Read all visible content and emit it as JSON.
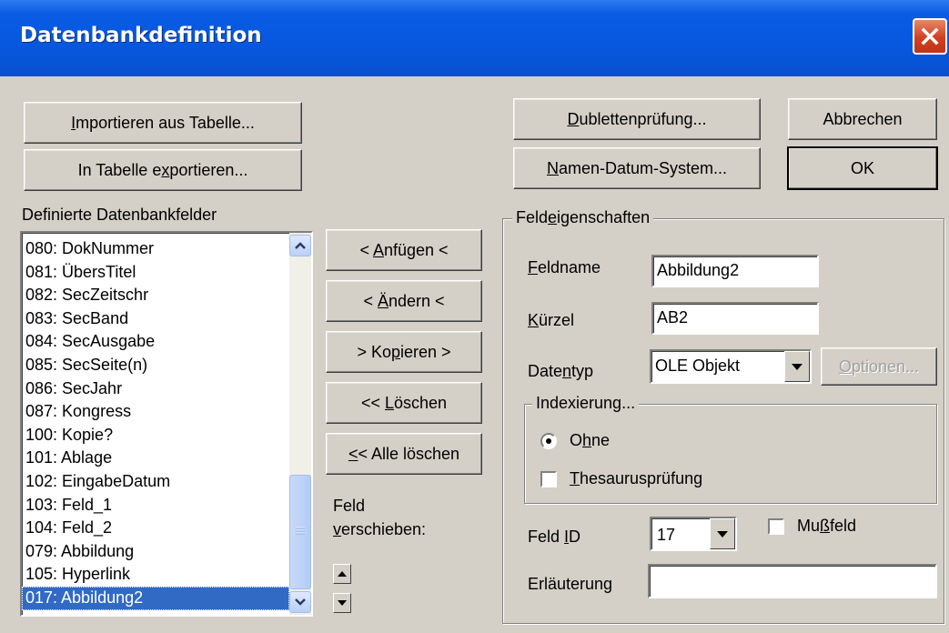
{
  "window": {
    "title": "Datenbankdefinition",
    "close_icon": "close-icon"
  },
  "buttons": {
    "import": {
      "pre": "",
      "key": "I",
      "post": "mportieren aus Tabelle..."
    },
    "export": {
      "pre": "In Tabelle e",
      "key": "x",
      "post": "portieren..."
    },
    "dubletten": {
      "pre": "",
      "key": "D",
      "post": "ublettenprüfung..."
    },
    "abbrechen": "Abbrechen",
    "namen": {
      "pre": "",
      "key": "N",
      "post": "amen-Datum-System..."
    },
    "ok": "OK",
    "anfuegen": {
      "pre": "< ",
      "key": "A",
      "post": "nfügen <"
    },
    "aendern": {
      "pre": "< ",
      "key": "Ä",
      "post": "ndern <"
    },
    "kopieren": {
      "pre": "> Ko",
      "key": "p",
      "post": "ieren >"
    },
    "loeschen": {
      "pre": "<< ",
      "key": "L",
      "post": "öschen"
    },
    "alle_loeschen": {
      "pre": "",
      "key": "<",
      "post": "< Alle löschen"
    },
    "optionen": {
      "pre": "",
      "key": "O",
      "post": "ptionen..."
    }
  },
  "fields_list": {
    "label": "Definierte Datenbankfelder",
    "items": [
      "080: DokNummer",
      "081: ÜbersTitel",
      "082: SecZeitschr",
      "083: SecBand",
      "084: SecAusgabe",
      "085: SecSeite(n)",
      "086: SecJahr",
      "087: Kongress",
      "100: Kopie?",
      "101: Ablage",
      "102: EingabeDatum",
      "103: Feld_1",
      "104: Feld_2",
      "079: Abbildung",
      "105: Hyperlink",
      "017: Abbildung2"
    ],
    "selected_index": 15
  },
  "move": {
    "line1": "Feld",
    "line2_key": "v",
    "line2_rest": "erschieben:"
  },
  "properties": {
    "legend": {
      "pre": "Feld",
      "key": "e",
      "post": "igenschaften"
    },
    "feldname_label": {
      "pre": "",
      "key": "F",
      "post": "eldname"
    },
    "feldname_value": "Abbildung2",
    "kuerzel_label": {
      "pre": "",
      "key": "K",
      "post": "ürzel"
    },
    "kuerzel_value": "AB2",
    "datentyp_label": {
      "pre": "Date",
      "key": "n",
      "post": "typ"
    },
    "datentyp_value": "OLE Objekt",
    "index_legend": "Indexierung...",
    "radio_ohne": {
      "pre": "O",
      "key": "h",
      "post": "ne"
    },
    "thesaurus": {
      "pre": "",
      "key": "T",
      "post": "hesaurusprüfung"
    },
    "feldid_label": {
      "pre": "Feld ",
      "key": "I",
      "post": "D"
    },
    "feldid_value": "17",
    "mussfeld": {
      "pre": "Mu",
      "key": "ß",
      "post": "feld"
    },
    "erlaeuterung_label": "Erläuterung",
    "erlaeuterung_value": ""
  }
}
